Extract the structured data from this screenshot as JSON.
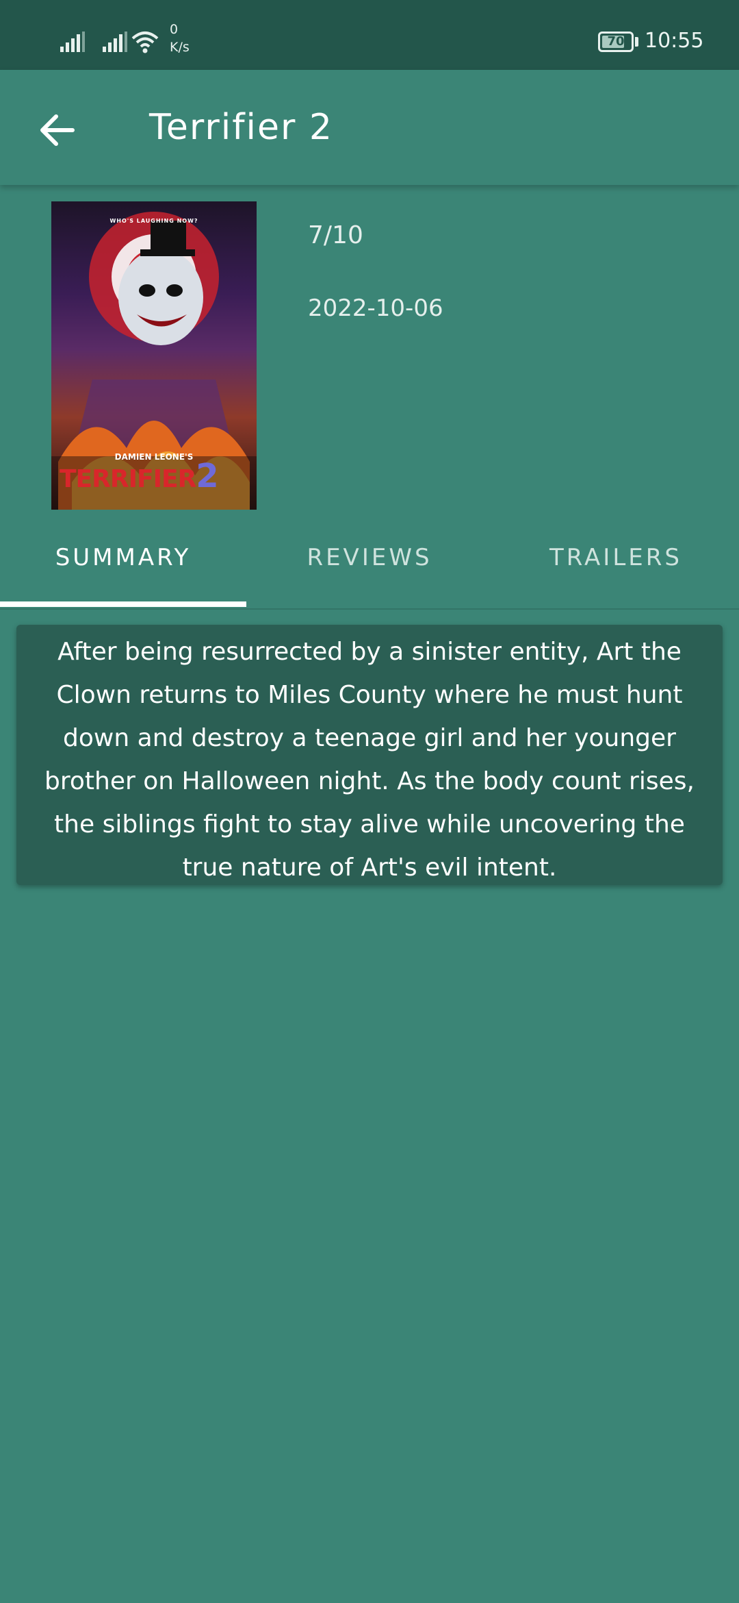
{
  "status_bar": {
    "speed_value": "0",
    "speed_unit": "K/s",
    "battery": "70",
    "time": "10:55"
  },
  "app_bar": {
    "title": "Terrifier 2",
    "back_icon": "arrow-back-icon"
  },
  "movie": {
    "rating": "7/10",
    "release_date": "2022-10-06",
    "poster": {
      "tagline": "WHO'S LAUGHING NOW?",
      "credit": "DAMIEN LEONE'S",
      "logo_text": "TERRIFIER",
      "logo_number": "2"
    }
  },
  "tabs": [
    {
      "label": "SUMMARY",
      "selected": true
    },
    {
      "label": "REVIEWS",
      "selected": false
    },
    {
      "label": "TRAILERS",
      "selected": false
    }
  ],
  "summary": {
    "text": "After being resurrected by a sinister entity, Art the Clown returns to Miles County where he must hunt down and destroy a teenage girl and her younger brother on Halloween night.  As the body count rises, the siblings fight to stay alive while uncovering the true nature of Art's evil intent."
  },
  "colors": {
    "background": "#3b8576",
    "status_bar": "#23564b",
    "card": "#2b5f54",
    "accent": "#ffffff"
  }
}
